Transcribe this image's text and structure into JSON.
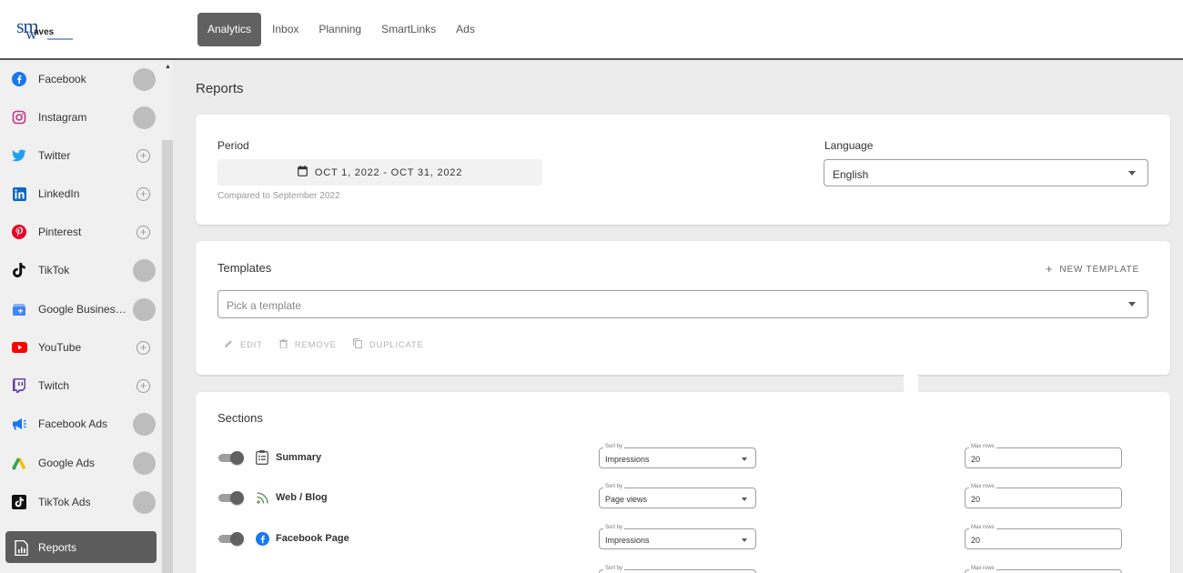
{
  "header": {
    "logo_text": "smwaves",
    "tabs": [
      {
        "label": "Analytics",
        "active": true
      },
      {
        "label": "Inbox"
      },
      {
        "label": "Planning"
      },
      {
        "label": "SmartLinks"
      },
      {
        "label": "Ads"
      }
    ]
  },
  "sidebar": {
    "items": [
      {
        "label": "Facebook",
        "icon": "facebook-icon",
        "state": "connected"
      },
      {
        "label": "Instagram",
        "icon": "instagram-icon",
        "state": "connected"
      },
      {
        "label": "Twitter",
        "icon": "twitter-icon",
        "state": "add"
      },
      {
        "label": "LinkedIn",
        "icon": "linkedin-icon",
        "state": "add"
      },
      {
        "label": "Pinterest",
        "icon": "pinterest-icon",
        "state": "add"
      },
      {
        "label": "TikTok",
        "icon": "tiktok-icon",
        "state": "connected"
      },
      {
        "label": "Google Business Profile",
        "icon": "google-business-icon",
        "state": "connected"
      },
      {
        "label": "YouTube",
        "icon": "youtube-icon",
        "state": "add"
      },
      {
        "label": "Twitch",
        "icon": "twitch-icon",
        "state": "add"
      },
      {
        "label": "Facebook Ads",
        "icon": "facebook-ads-icon",
        "state": "connected"
      },
      {
        "label": "Google Ads",
        "icon": "google-ads-icon",
        "state": "connected"
      },
      {
        "label": "TikTok Ads",
        "icon": "tiktok-ads-icon",
        "state": "connected"
      }
    ],
    "active_item": {
      "label": "Reports",
      "icon": "reports-icon"
    }
  },
  "main": {
    "title": "Reports",
    "period": {
      "label": "Period",
      "value": "OCT 1, 2022 - OCT 31, 2022",
      "compared": "Compared to September 2022"
    },
    "language": {
      "label": "Language",
      "value": "English"
    },
    "templates": {
      "title": "Templates",
      "new_label": "NEW TEMPLATE",
      "placeholder": "Pick a template",
      "actions": {
        "edit": "EDIT",
        "remove": "REMOVE",
        "duplicate": "DUPLICATE"
      }
    },
    "sections": {
      "title": "Sections",
      "sort_caption": "Sort by",
      "max_caption": "Max rows",
      "rows": [
        {
          "name": "Summary",
          "icon": "summary-icon",
          "enabled": true,
          "sort": "Impressions",
          "max_rows": "20"
        },
        {
          "name": "Web / Blog",
          "icon": "rss-icon",
          "enabled": true,
          "sort": "Page views",
          "max_rows": "20"
        },
        {
          "name": "Facebook Page",
          "icon": "facebook-icon",
          "enabled": true,
          "sort": "Impressions",
          "max_rows": "20"
        }
      ]
    }
  },
  "colors": {
    "accent": "#616161",
    "facebook": "#1877f2",
    "instagram": "#c13584",
    "twitter": "#1da1f2",
    "linkedin": "#0a66c2",
    "pinterest": "#e60023",
    "youtube": "#ff0000",
    "twitch": "#6441a5"
  }
}
